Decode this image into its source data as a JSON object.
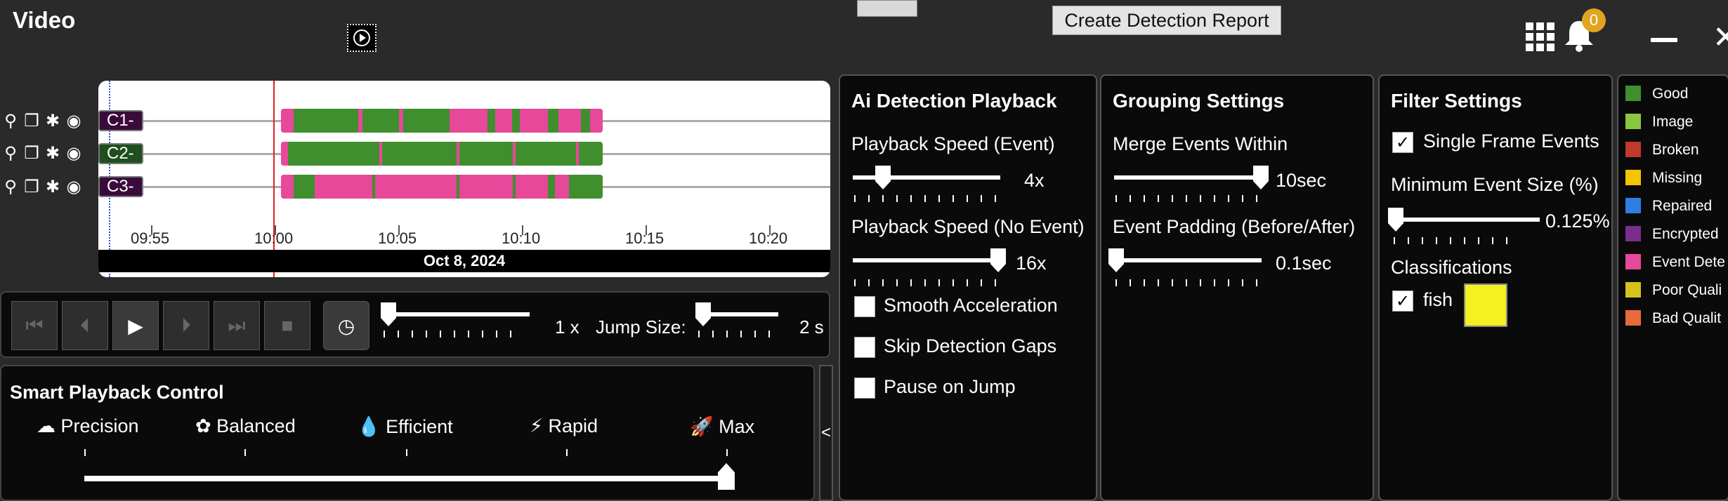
{
  "window": {
    "title": "Video"
  },
  "toolbar": {
    "create_report_label": "Create Detection Report",
    "notification_count": "0"
  },
  "timeline": {
    "channels": [
      {
        "label": "C1-"
      },
      {
        "label": "C2-"
      },
      {
        "label": "C3-"
      }
    ],
    "ticks": [
      "09:55",
      "10:00",
      "10:05",
      "10:10",
      "10:15",
      "10:20"
    ],
    "date": "Oct 8, 2024"
  },
  "playback": {
    "speed_value": "1 x",
    "jump_label": "Jump Size:",
    "jump_value": "2 s"
  },
  "smart_playback": {
    "title": "Smart Playback Control",
    "modes": [
      "Precision",
      "Balanced",
      "Efficient",
      "Rapid",
      "Max"
    ],
    "selected": "Max"
  },
  "ai_panel": {
    "title": "Ai Detection Playback",
    "speed_event_label": "Playback Speed (Event)",
    "speed_event_value": "4x",
    "speed_noevent_label": "Playback Speed (No Event)",
    "speed_noevent_value": "16x",
    "smooth_label": "Smooth Acceleration",
    "skip_label": "Skip Detection Gaps",
    "pause_label": "Pause on Jump",
    "smooth_checked": false,
    "skip_checked": false,
    "pause_checked": false
  },
  "grouping_panel": {
    "title": "Grouping Settings",
    "merge_label": "Merge Events Within",
    "merge_value": "10sec",
    "padding_label": "Event Padding (Before/After)",
    "padding_value": "0.1sec"
  },
  "filter_panel": {
    "title": "Filter Settings",
    "single_frame_label": "Single Frame Events",
    "single_frame_checked": true,
    "min_size_label": "Minimum Event Size (%)",
    "min_size_value": "0.125%",
    "classifications_label": "Classifications",
    "class_fish_label": "fish",
    "class_fish_checked": true,
    "class_fish_color": "#f5f020"
  },
  "legend": {
    "items": [
      {
        "label": "Good",
        "color": "#3f8f2f"
      },
      {
        "label": "Image",
        "color": "#8cc63f"
      },
      {
        "label": "Broken",
        "color": "#c0392b"
      },
      {
        "label": "Missing",
        "color": "#f5c400"
      },
      {
        "label": "Repaired",
        "color": "#2f7de1"
      },
      {
        "label": "Encrypted",
        "color": "#7b2d8e"
      },
      {
        "label": "Event Dete",
        "color": "#e8489a"
      },
      {
        "label": "Poor Quali",
        "color": "#d4c41c"
      },
      {
        "label": "Bad Qualit",
        "color": "#e86a3a"
      }
    ]
  }
}
